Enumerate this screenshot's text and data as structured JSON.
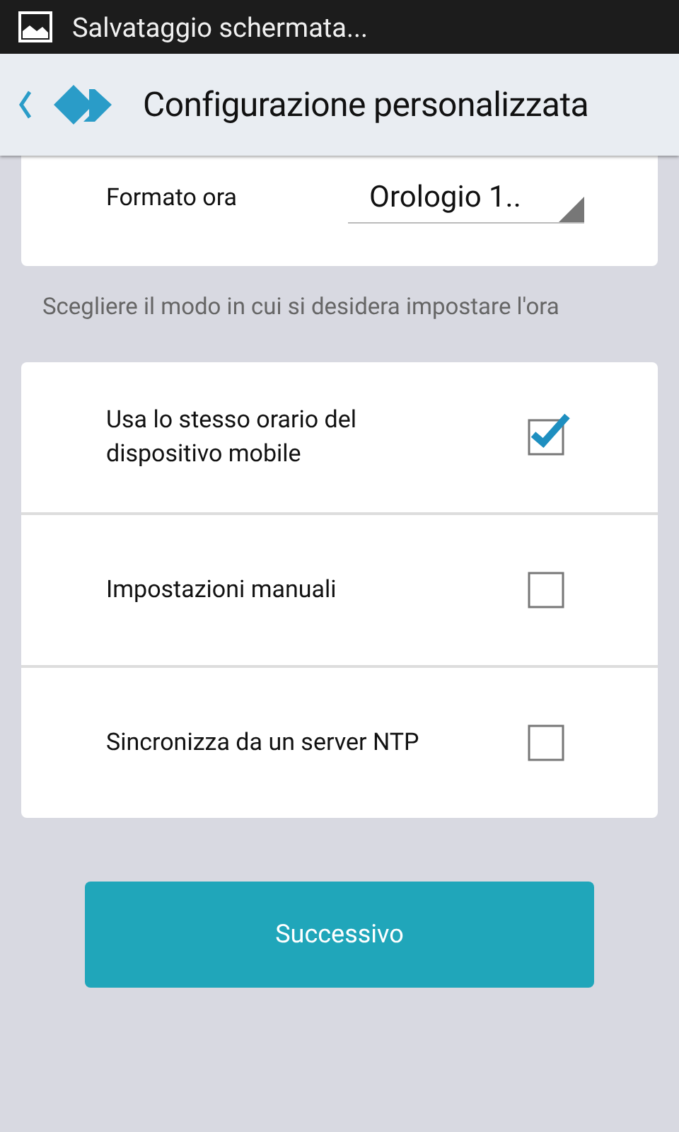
{
  "status_bar": {
    "notification": "Salvataggio schermata..."
  },
  "header": {
    "title": "Configurazione personalizzata"
  },
  "time_format": {
    "label": "Formato ora",
    "value": "Orologio 1.."
  },
  "hint": "Scegliere il modo in cui si desidera impostare l'ora",
  "options": [
    {
      "label": "Usa lo stesso orario del dispositivo mobile",
      "checked": true
    },
    {
      "label": "Impostazioni manuali",
      "checked": false
    },
    {
      "label": "Sincronizza da un server NTP",
      "checked": false
    }
  ],
  "next_button": "Successivo"
}
